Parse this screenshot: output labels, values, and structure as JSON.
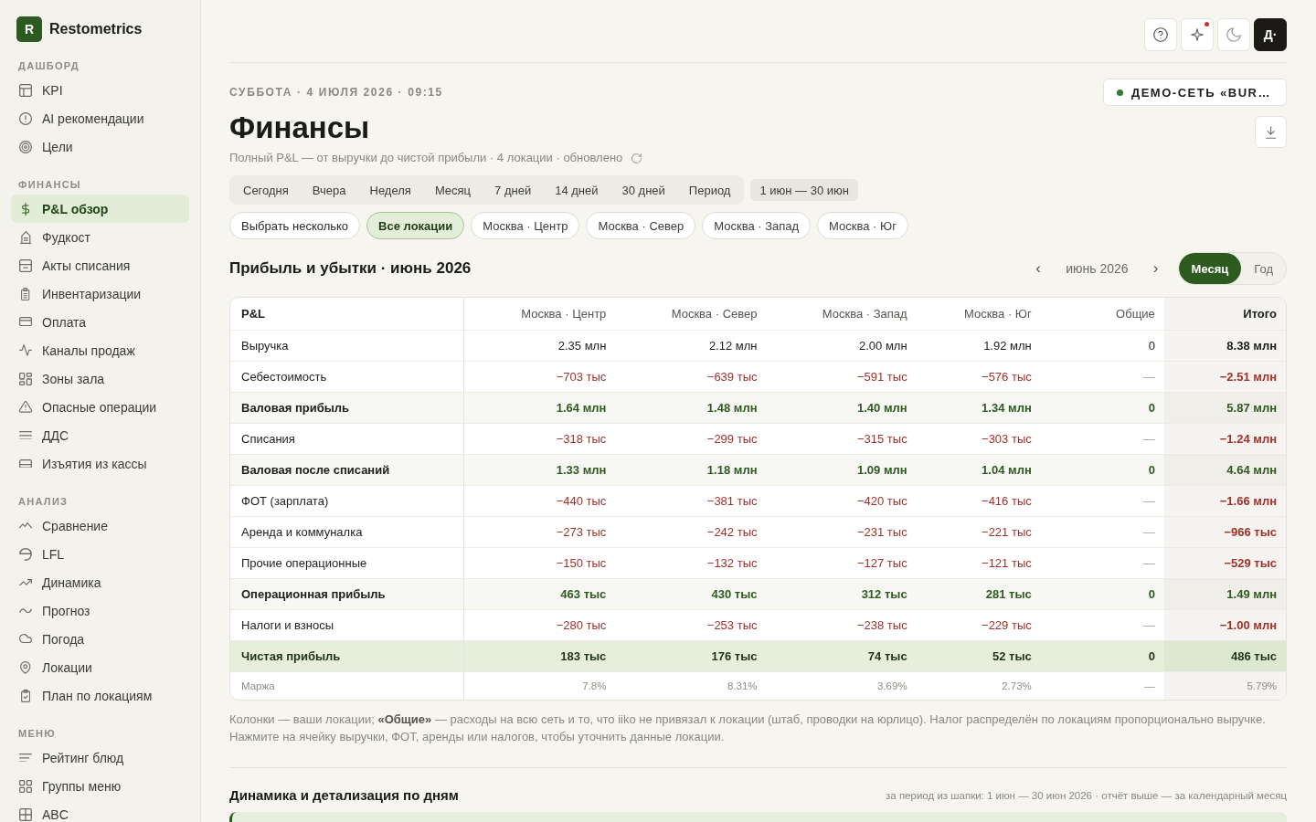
{
  "sidebar": {
    "logo": {
      "letter": "R",
      "name": "Restometrics"
    },
    "sections": [
      {
        "title": "ДАШБОРД",
        "items": [
          {
            "label": "KPI",
            "selected": false
          },
          {
            "label": "AI рекомендации",
            "selected": false
          },
          {
            "label": "Цели",
            "selected": false
          }
        ]
      },
      {
        "title": "ФИНАНСЫ",
        "items": [
          {
            "label": "P&L обзор",
            "selected": true
          },
          {
            "label": "Фудкост",
            "selected": false
          },
          {
            "label": "Акты списания",
            "selected": false
          },
          {
            "label": "Инвентаризации",
            "selected": false
          },
          {
            "label": "Оплата",
            "selected": false
          },
          {
            "label": "Каналы продаж",
            "selected": false
          },
          {
            "label": "Зоны зала",
            "selected": false
          },
          {
            "label": "Опасные операции",
            "selected": false
          },
          {
            "label": "ДДС",
            "selected": false
          },
          {
            "label": "Изъятия из кассы",
            "selected": false
          }
        ]
      },
      {
        "title": "АНАЛИЗ",
        "items": [
          {
            "label": "Сравнение",
            "selected": false
          },
          {
            "label": "LFL",
            "selected": false
          },
          {
            "label": "Динамика",
            "selected": false
          },
          {
            "label": "Прогноз",
            "selected": false
          },
          {
            "label": "Погода",
            "selected": false
          },
          {
            "label": "Локации",
            "selected": false
          },
          {
            "label": "План по локациям",
            "selected": false
          }
        ]
      },
      {
        "title": "МЕНЮ",
        "items": [
          {
            "label": "Рейтинг блюд",
            "selected": false
          },
          {
            "label": "Группы меню",
            "selected": false
          },
          {
            "label": "ABC",
            "selected": false
          }
        ]
      }
    ]
  },
  "topbar": {
    "ai_notification": true,
    "avatar": "Д·"
  },
  "header": {
    "date": "СУББОТА · 4 ИЮЛЯ 2026 · 09:15",
    "title": "Финансы",
    "subtitle": "Полный P&L — от выручки до чистой прибыли · 4 локации · обновлено",
    "network": {
      "label": "ДЕМО-СЕТЬ «BUR…",
      "connected": true
    }
  },
  "periods": {
    "tabs": [
      {
        "label": "Сегодня",
        "selected": false
      },
      {
        "label": "Вчера",
        "selected": false
      },
      {
        "label": "Неделя",
        "selected": false
      },
      {
        "label": "Месяц",
        "selected": false
      },
      {
        "label": "7 дней",
        "selected": false
      },
      {
        "label": "14 дней",
        "selected": false
      },
      {
        "label": "30 дней",
        "selected": false
      },
      {
        "label": "Период",
        "selected": false
      }
    ],
    "range": "1 июн — 30 июн"
  },
  "location_filter": {
    "multi_select": "Выбрать несколько",
    "locations": [
      {
        "label": "Все локации",
        "selected": true
      },
      {
        "label": "Москва · Центр",
        "selected": false
      },
      {
        "label": "Москва · Север",
        "selected": false
      },
      {
        "label": "Москва · Запад",
        "selected": false
      },
      {
        "label": "Москва · Юг",
        "selected": false
      }
    ]
  },
  "pnl": {
    "title": "Прибыль и убытки · июнь 2026",
    "month_nav": {
      "prev": "‹",
      "month": "июнь 2026",
      "next": "›"
    },
    "granularity": [
      {
        "label": "Месяц",
        "selected": true
      },
      {
        "label": "Год",
        "selected": false
      }
    ],
    "table": {
      "columns": [
        {
          "label": "P&L",
          "kind": "label"
        },
        {
          "label": "Москва · Центр",
          "kind": "location"
        },
        {
          "label": "Москва · Север",
          "kind": "location"
        },
        {
          "label": "Москва · Запад",
          "kind": "location"
        },
        {
          "label": "Москва · Юг",
          "kind": "location"
        },
        {
          "label": "Общие",
          "kind": "shared"
        },
        {
          "label": "Итого",
          "kind": "total"
        }
      ],
      "rows": [
        {
          "kind": "revenue",
          "cells": [
            "Выручка",
            "2.35 млн",
            "2.12 млн",
            "2.00 млн",
            "1.92 млн",
            "0",
            "8.38 млн"
          ]
        },
        {
          "kind": "cost",
          "cells": [
            "Себестоимость",
            "−703 тыс",
            "−639 тыс",
            "−591 тыс",
            "−576 тыс",
            "—",
            "−2.51 млн"
          ]
        },
        {
          "kind": "subtotal",
          "cells": [
            "Валовая прибыль",
            "1.64 млн",
            "1.48 млн",
            "1.40 млн",
            "1.34 млн",
            "0",
            "5.87 млн"
          ]
        },
        {
          "kind": "cost",
          "cells": [
            "Списания",
            "−318 тыс",
            "−299 тыс",
            "−315 тыс",
            "−303 тыс",
            "—",
            "−1.24 млн"
          ]
        },
        {
          "kind": "subtotal",
          "cells": [
            "Валовая после списаний",
            "1.33 млн",
            "1.18 млн",
            "1.09 млн",
            "1.04 млн",
            "0",
            "4.64 млн"
          ]
        },
        {
          "kind": "cost",
          "cells": [
            "ФОТ (зарплата)",
            "−440 тыс",
            "−381 тыс",
            "−420 тыс",
            "−416 тыс",
            "—",
            "−1.66 млн"
          ]
        },
        {
          "kind": "cost",
          "cells": [
            "Аренда и коммуналка",
            "−273 тыс",
            "−242 тыс",
            "−231 тыс",
            "−221 тыс",
            "—",
            "−966 тыс"
          ]
        },
        {
          "kind": "cost",
          "cells": [
            "Прочие операционные",
            "−150 тыс",
            "−132 тыс",
            "−127 тыс",
            "−121 тыс",
            "—",
            "−529 тыс"
          ]
        },
        {
          "kind": "subtotal",
          "cells": [
            "Операционная прибыль",
            "463 тыс",
            "430 тыс",
            "312 тыс",
            "281 тыс",
            "0",
            "1.49 млн"
          ]
        },
        {
          "kind": "cost",
          "cells": [
            "Налоги и взносы",
            "−280 тыс",
            "−253 тыс",
            "−238 тыс",
            "−229 тыс",
            "—",
            "−1.00 млн"
          ]
        },
        {
          "kind": "net",
          "cells": [
            "Чистая прибыль",
            "183 тыс",
            "176 тыс",
            "74 тыс",
            "52 тыс",
            "0",
            "486 тыс"
          ]
        },
        {
          "kind": "margin",
          "cells": [
            "Маржа",
            "7.8%",
            "8.31%",
            "3.69%",
            "2.73%",
            "—",
            "5.79%"
          ]
        }
      ]
    },
    "notes": [
      "Колонки — ваши локации; **«Общие»** — расходы на всю сеть и то, что iiko не привязал к локации (штаб, проводки на юрлицо). Налог распределён по локациям пропорционально выручке.",
      "Нажмите на ячейку выручки, ФОТ, аренды или налогов, чтобы уточнить данные локации."
    ]
  },
  "daily": {
    "title": "Динамика и детализация по дням",
    "caption": "за период из шапки: 1 июн — 30 июн 2026 · отчёт выше — за календарный месяц"
  }
}
